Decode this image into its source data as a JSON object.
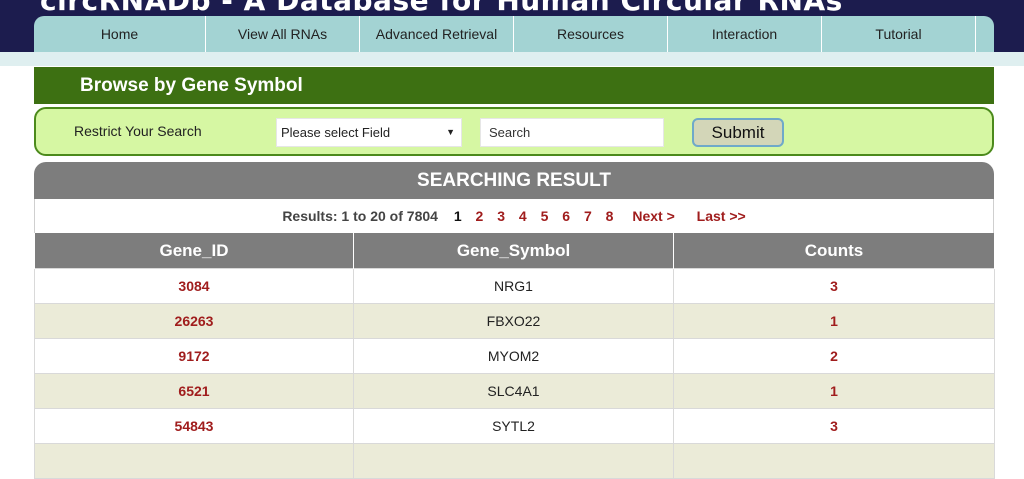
{
  "site": {
    "title": "circRNADb - A Database for Human Circular RNAs"
  },
  "nav": {
    "items": [
      {
        "label": "Home"
      },
      {
        "label": "View All RNAs"
      },
      {
        "label": "Advanced Retrieval"
      },
      {
        "label": "Resources"
      },
      {
        "label": "Interaction"
      },
      {
        "label": "Tutorial"
      }
    ]
  },
  "browse": {
    "title": "Browse by Gene Symbol"
  },
  "search": {
    "restrict_label": "Restrict Your Search",
    "field_value": "Please select Field",
    "query_placeholder": "Search",
    "submit_label": "Submit"
  },
  "results": {
    "heading": "SEARCHING RESULT",
    "summary": "Results: 1 to 20 of 7804",
    "current_page": "1",
    "pages": [
      "2",
      "3",
      "4",
      "5",
      "6",
      "7",
      "8"
    ],
    "next_label": "Next >",
    "last_label": "Last >>",
    "columns": [
      "Gene_ID",
      "Gene_Symbol",
      "Counts"
    ],
    "rows": [
      {
        "gene_id": "3084",
        "gene_symbol": "NRG1",
        "counts": "3"
      },
      {
        "gene_id": "26263",
        "gene_symbol": "FBXO22",
        "counts": "1"
      },
      {
        "gene_id": "9172",
        "gene_symbol": "MYOM2",
        "counts": "2"
      },
      {
        "gene_id": "6521",
        "gene_symbol": "SLC4A1",
        "counts": "1"
      },
      {
        "gene_id": "54843",
        "gene_symbol": "SYTL2",
        "counts": "3"
      }
    ]
  }
}
